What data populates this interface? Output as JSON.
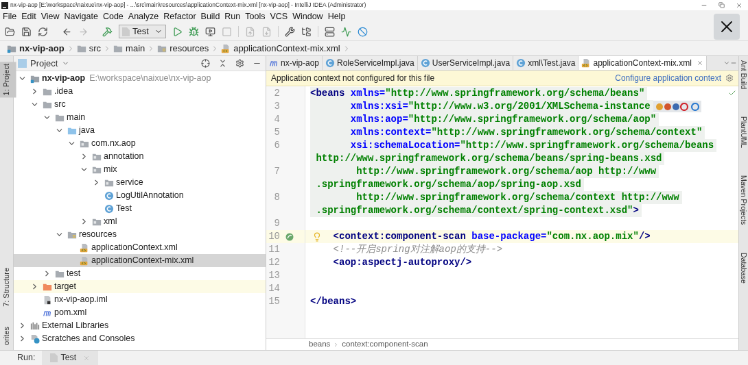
{
  "window": {
    "title": "nx-vip-aop [E:\\workspace\\naixue\\nx-vip-aop] - ...\\src\\main\\resources\\applicationContext-mix.xml [nx-vip-aop] - IntelliJ IDEA (Administrator)"
  },
  "menu": [
    "File",
    "Edit",
    "View",
    "Navigate",
    "Code",
    "Analyze",
    "Refactor",
    "Build",
    "Run",
    "Tools",
    "VCS",
    "Window",
    "Help"
  ],
  "toolbar": {
    "run_config": "Test"
  },
  "navbar": [
    {
      "label": "nx-vip-aop",
      "kind": "module"
    },
    {
      "label": "src",
      "kind": "folder"
    },
    {
      "label": "main",
      "kind": "folder"
    },
    {
      "label": "resources",
      "kind": "resources"
    },
    {
      "label": "applicationContext-mix.xml",
      "kind": "xml"
    }
  ],
  "left_stripe": [
    {
      "label": "1: Project",
      "selected": true
    },
    {
      "label": "7: Structure",
      "selected": false
    },
    {
      "label": "orites",
      "selected": false
    }
  ],
  "right_stripe": [
    "Ant Build",
    "PlantUML",
    "Maven Projects",
    "Database"
  ],
  "project": {
    "title": "Project",
    "tree": [
      {
        "label": "nx-vip-aop",
        "path": "E:\\workspace\\naixue\\nx-vip-aop",
        "kind": "module",
        "expanded": true,
        "selected": false,
        "children": [
          {
            "label": ".idea",
            "kind": "folder",
            "expanded": false,
            "selected": false
          },
          {
            "label": "src",
            "kind": "folder",
            "expanded": true,
            "selected": false,
            "children": [
              {
                "label": "main",
                "kind": "folder",
                "expanded": true,
                "selected": false,
                "children": [
                  {
                    "label": "java",
                    "kind": "source-folder",
                    "expanded": true,
                    "selected": false,
                    "children": [
                      {
                        "label": "com.nx.aop",
                        "kind": "package",
                        "expanded": true,
                        "selected": false,
                        "children": [
                          {
                            "label": "annotation",
                            "kind": "package",
                            "expanded": false,
                            "selected": false
                          },
                          {
                            "label": "mix",
                            "kind": "package",
                            "expanded": true,
                            "selected": false,
                            "children": [
                              {
                                "label": "service",
                                "kind": "package",
                                "expanded": false,
                                "selected": false
                              },
                              {
                                "label": "LogUtilAnnotation",
                                "kind": "class",
                                "selected": false
                              },
                              {
                                "label": "Test",
                                "kind": "class",
                                "selected": false
                              }
                            ]
                          },
                          {
                            "label": "xml",
                            "kind": "package",
                            "expanded": false,
                            "selected": false
                          }
                        ]
                      }
                    ]
                  },
                  {
                    "label": "resources",
                    "kind": "resources",
                    "expanded": true,
                    "selected": false,
                    "children": [
                      {
                        "label": "applicationContext.xml",
                        "kind": "xml",
                        "selected": false
                      },
                      {
                        "label": "applicationContext-mix.xml",
                        "kind": "xml",
                        "selected": true
                      }
                    ]
                  }
                ]
              },
              {
                "label": "test",
                "kind": "folder",
                "expanded": false,
                "selected": false
              }
            ]
          },
          {
            "label": "target",
            "kind": "excluded",
            "expanded": false,
            "selected": false
          },
          {
            "label": "nx-vip-aop.iml",
            "kind": "iml",
            "selected": false
          },
          {
            "label": "pom.xml",
            "kind": "pom",
            "selected": false
          }
        ]
      },
      {
        "label": "External Libraries",
        "kind": "libraries",
        "expanded": false,
        "selected": false
      },
      {
        "label": "Scratches and Consoles",
        "kind": "scratches",
        "expanded": false,
        "selected": false
      }
    ]
  },
  "editor": {
    "tabs": [
      {
        "label": "nx-vip-aop",
        "kind": "pom",
        "selected": false
      },
      {
        "label": "RoleServiceImpl.java",
        "kind": "class",
        "selected": false
      },
      {
        "label": "UserServiceImpl.java",
        "kind": "class",
        "selected": false
      },
      {
        "label": "xml\\Test.java",
        "kind": "class",
        "selected": false
      },
      {
        "label": "applicationContext-mix.xml",
        "kind": "xml",
        "selected": true
      }
    ],
    "banner": {
      "message": "Application context not configured for this file",
      "link": "Configure application context"
    },
    "lines": [
      {
        "number": "2",
        "shaded": true,
        "current": false,
        "segments": [
          {
            "kind": "tag",
            "text": "<beans "
          },
          {
            "kind": "attr",
            "text": "xmlns="
          },
          {
            "kind": "value",
            "text": "\"http://www.springframework.org/schema/beans\""
          }
        ]
      },
      {
        "number": "3",
        "shaded": true,
        "current": false,
        "browsers": true,
        "segments": [
          {
            "kind": "attr",
            "text": "       xmlns:xsi="
          },
          {
            "kind": "value",
            "text": "\"http://www.w3.org/2001/XMLSchema-instance"
          }
        ]
      },
      {
        "number": "4",
        "shaded": true,
        "current": false,
        "segments": [
          {
            "kind": "attr",
            "text": "       xmlns:aop="
          },
          {
            "kind": "value",
            "text": "\"http://www.springframework.org/schema/aop\""
          }
        ]
      },
      {
        "number": "5",
        "shaded": true,
        "current": false,
        "segments": [
          {
            "kind": "attr",
            "text": "       xmlns:context="
          },
          {
            "kind": "value",
            "text": "\"http://www.springframework.org/schema/context\""
          }
        ]
      },
      {
        "number": "6",
        "shaded": true,
        "current": false,
        "segments": [
          {
            "kind": "attr",
            "text": "       xsi:schemaLocation="
          },
          {
            "kind": "value",
            "text": "\"http://www.springframework.org/schema/beans"
          }
        ]
      },
      {
        "shaded": true,
        "current": false,
        "segments": [
          {
            "kind": "value",
            "text": " http://www.springframework.org/schema/beans/spring-beans.xsd"
          }
        ]
      },
      {
        "number": "7",
        "shaded": true,
        "current": false,
        "segments": [
          {
            "kind": "value",
            "text": "        http://www.springframework.org/schema/aop http://www"
          }
        ]
      },
      {
        "shaded": true,
        "current": false,
        "segments": [
          {
            "kind": "value",
            "text": " .springframework.org/schema/aop/spring-aop.xsd"
          }
        ]
      },
      {
        "number": "8",
        "shaded": true,
        "current": false,
        "segments": [
          {
            "kind": "value",
            "text": "        http://www.springframework.org/schema/context http://www"
          }
        ]
      },
      {
        "shaded": true,
        "current": false,
        "segments": [
          {
            "kind": "value",
            "text": " .springframework.org/schema/context/spring-context.xsd\""
          },
          {
            "kind": "tag",
            "text": ">"
          }
        ]
      },
      {
        "number": "9",
        "current": false
      },
      {
        "number": "10",
        "shaded": false,
        "current": true,
        "bean_marker": true,
        "bulb": true,
        "segments": [
          {
            "kind": "tag",
            "text": "<context:component-scan "
          },
          {
            "kind": "attr",
            "text": "base-package="
          },
          {
            "kind": "value",
            "text": "\"com.nx.aop.mix\""
          },
          {
            "kind": "tag",
            "text": "/>"
          }
        ]
      },
      {
        "number": "11",
        "shaded": false,
        "current": false,
        "segments": [
          {
            "kind": "comment",
            "text": "    <!--开启spring对注解aop的支持-->"
          }
        ]
      },
      {
        "number": "12",
        "shaded": false,
        "current": false,
        "segments": [
          {
            "kind": "tag",
            "text": "    <aop:aspectj-autoproxy/>"
          }
        ]
      },
      {
        "number": "13",
        "current": false
      },
      {
        "number": "14",
        "current": false
      },
      {
        "number": "15",
        "shaded": false,
        "current": false,
        "segments": [
          {
            "kind": "tag",
            "text": "</beans>"
          }
        ]
      }
    ],
    "breadcrumbs": [
      "beans",
      "context:component-scan"
    ]
  },
  "run_bar": {
    "label": "Run:",
    "tab": "Test"
  }
}
